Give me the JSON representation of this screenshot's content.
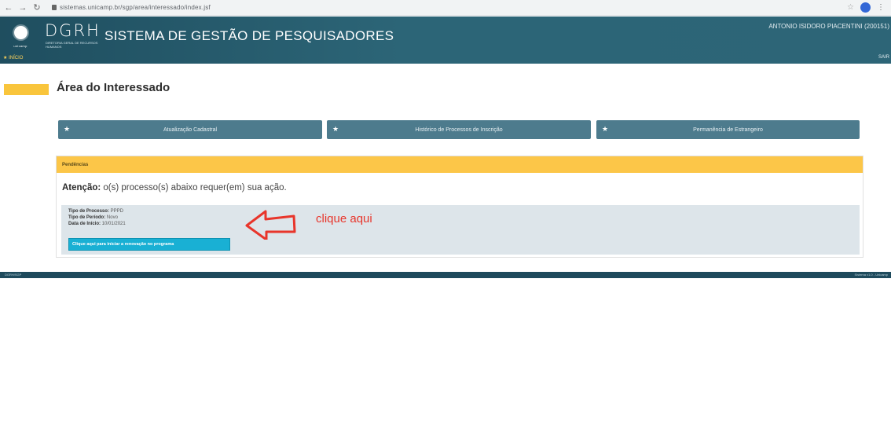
{
  "browser": {
    "back": "←",
    "forward": "→",
    "reload": "↻",
    "url": "sistemas.unicamp.br/sgp/area/interessado/index.jsf",
    "star": "☆",
    "menu": "⋮"
  },
  "header": {
    "logo_word": "unicamp",
    "dgrh_mark": "DGRH",
    "dgrh_sub": "DIRETORIA GERAL DE RECURSOS HUMANOS",
    "system_title": "SISTEMA DE GESTÃO DE PESQUISADORES",
    "user_name": "ANTONIO ISIDORO PIACENTINI (200151)",
    "nav_home": "INÍCIO",
    "nav_exit": "SAIR"
  },
  "main": {
    "title": "Área do Interessado",
    "actions": [
      {
        "label": "Atualização Cadastral"
      },
      {
        "label": "Histórico de Processos de Inscrição"
      },
      {
        "label": "Permanência de Estrangeiro"
      }
    ],
    "panel": {
      "heading": "Pendências",
      "attention_bold": "Atenção:",
      "attention_text": " o(s) processo(s) abaixo requer(em) sua ação.",
      "process": {
        "type_label": "Tipo de Processo:",
        "type_value": " PPPD",
        "period_label": "Tipo de Período:",
        "period_value": " Novo",
        "start_label": "Data de Início:",
        "start_value": " 10/01/2021"
      },
      "renew_button": "Clique aqui para iniciar a renovação no programa"
    },
    "annotation": "clique aqui"
  },
  "footer": {
    "left": "DGRH/SGP",
    "right": "Sistema v1.0 - Unicamp"
  },
  "colors": {
    "header": "#2c6577",
    "accent": "#fcc648",
    "action_button": "#4d7b8d",
    "renew_button": "#19b0d4",
    "annotation": "#e8352b"
  }
}
